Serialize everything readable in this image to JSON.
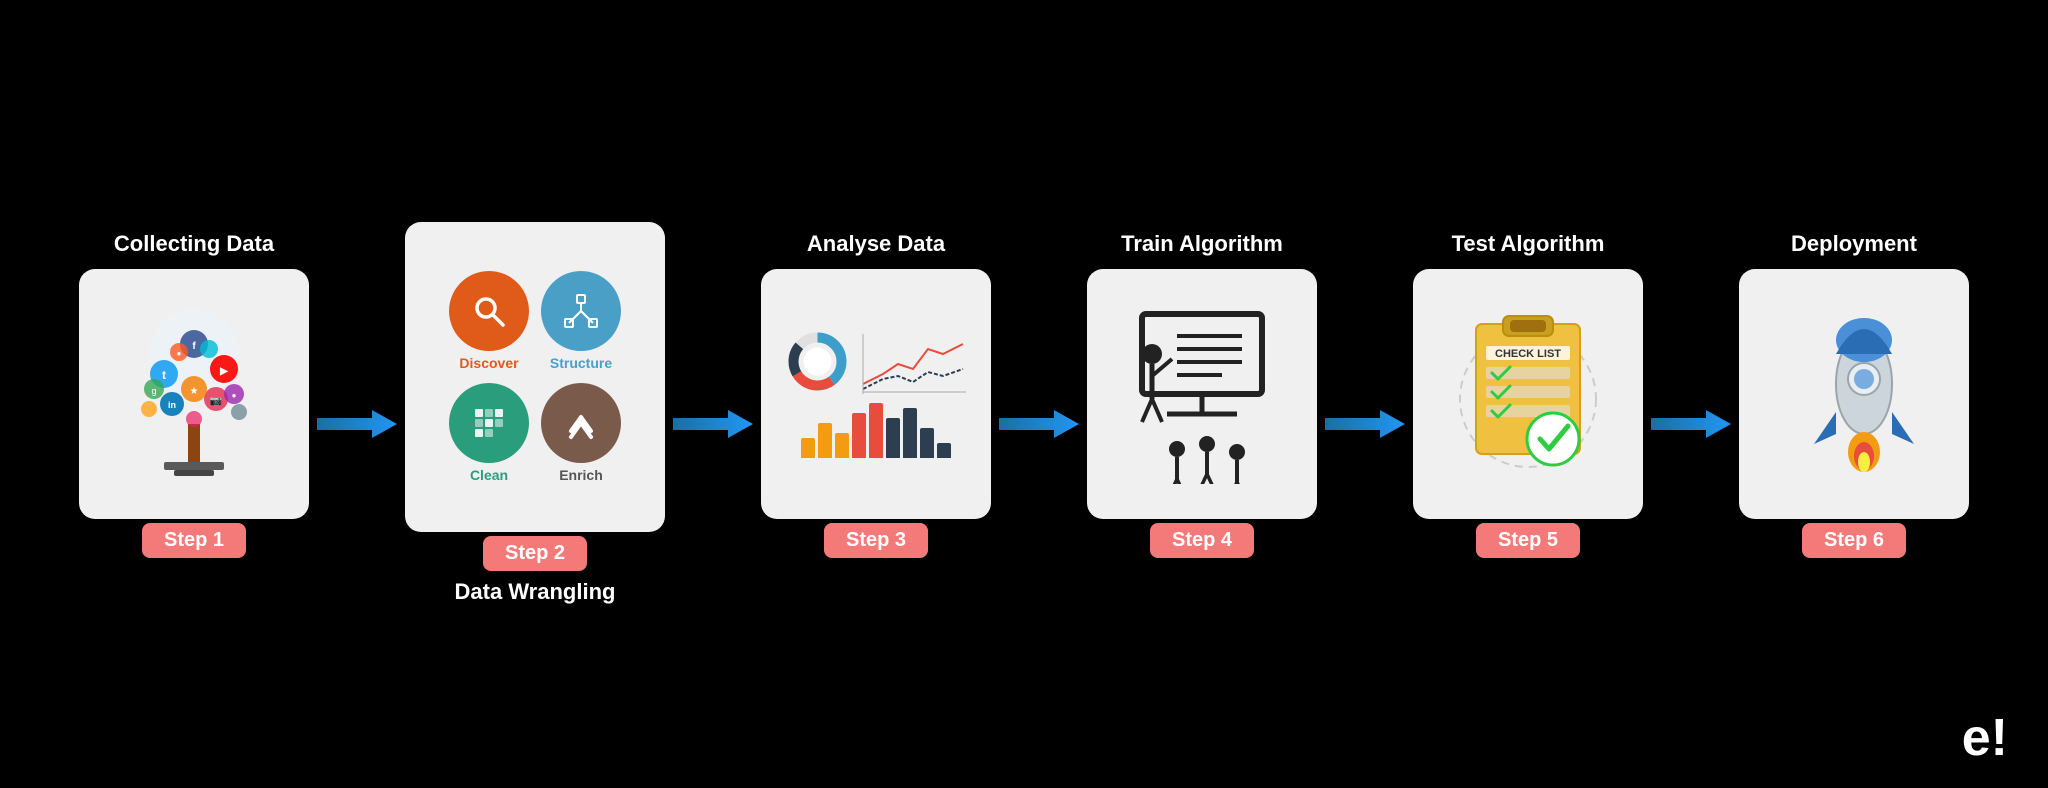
{
  "steps": [
    {
      "id": 1,
      "top_label": "Collecting Data",
      "bottom_label": "",
      "badge": "Step 1"
    },
    {
      "id": 2,
      "top_label": "",
      "bottom_label": "Data Wrangling",
      "badge": "Step 2",
      "wrangling": [
        {
          "label": "Discover",
          "color_class": "circle-orange",
          "label_class": "label-orange"
        },
        {
          "label": "Structure",
          "color_class": "circle-blue",
          "label_class": "label-blue"
        },
        {
          "label": "Clean",
          "color_class": "circle-teal",
          "label_class": "label-teal"
        },
        {
          "label": "Enrich",
          "color_class": "circle-brown",
          "label_class": "label-dark"
        }
      ]
    },
    {
      "id": 3,
      "top_label": "Analyse Data",
      "bottom_label": "",
      "badge": "Step 3"
    },
    {
      "id": 4,
      "top_label": "Train Algorithm",
      "bottom_label": "",
      "badge": "Step 4"
    },
    {
      "id": 5,
      "top_label": "Test Algorithm",
      "bottom_label": "",
      "badge": "Step 5"
    },
    {
      "id": 6,
      "top_label": "Deployment",
      "bottom_label": "",
      "badge": "Step 6"
    }
  ],
  "watermark": "e!",
  "arrows": [
    "→",
    "→",
    "→",
    "→",
    "→"
  ]
}
